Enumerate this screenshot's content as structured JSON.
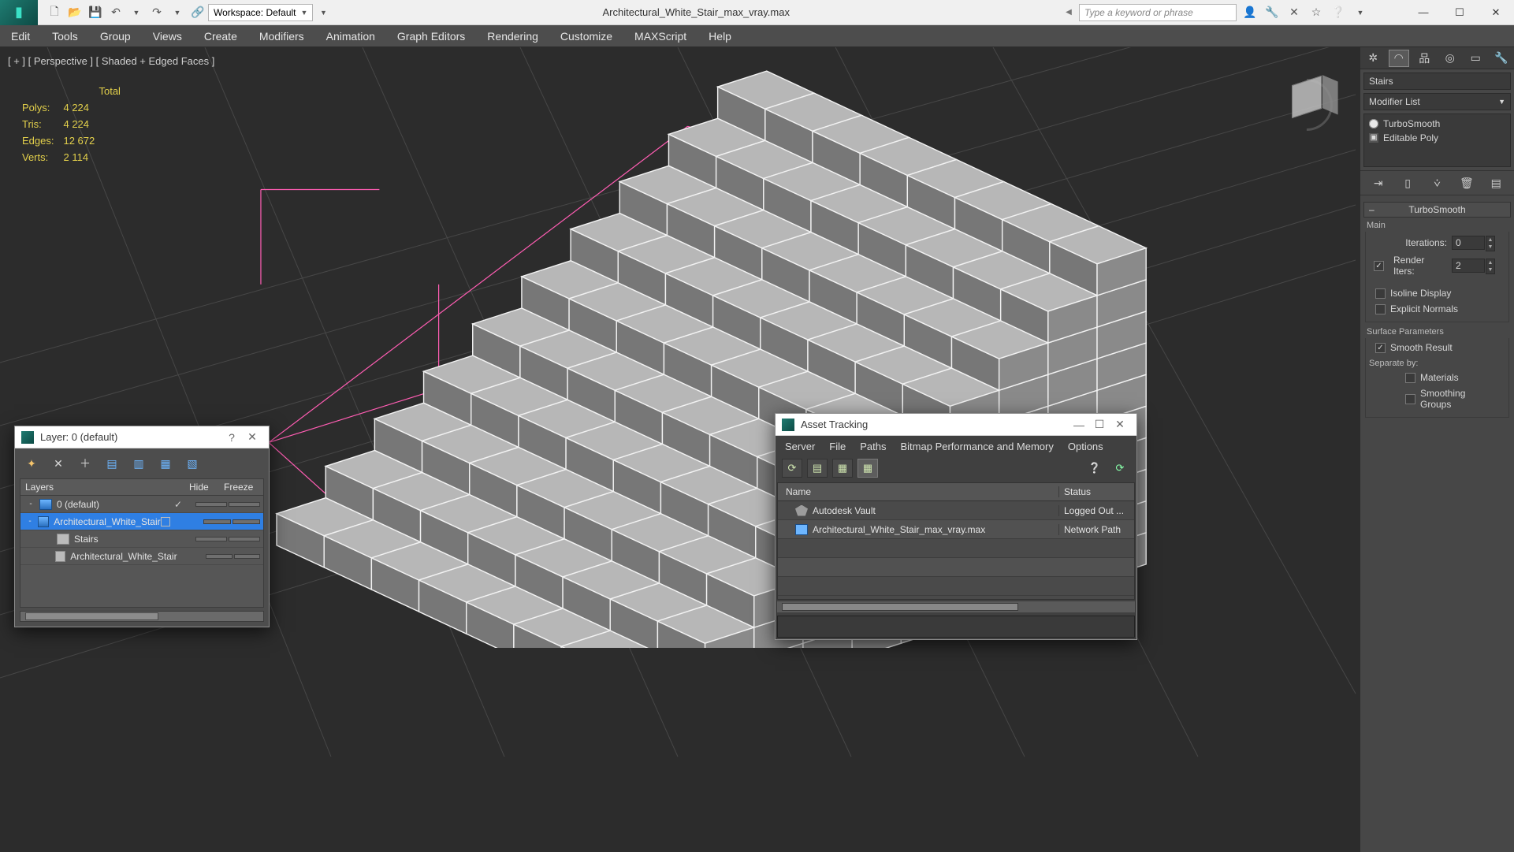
{
  "titlebar": {
    "workspace_label": "Workspace: Default",
    "title": "Architectural_White_Stair_max_vray.max",
    "search_placeholder": "Type a keyword or phrase"
  },
  "mainmenu": [
    "Edit",
    "Tools",
    "Group",
    "Views",
    "Create",
    "Modifiers",
    "Animation",
    "Graph Editors",
    "Rendering",
    "Customize",
    "MAXScript",
    "Help"
  ],
  "viewport": {
    "label": "[ + ] [ Perspective ] [ Shaded + Edged Faces ]",
    "stats_header": "Total",
    "stats": {
      "polys_label": "Polys:",
      "polys": "4 224",
      "tris_label": "Tris:",
      "tris": "4 224",
      "edges_label": "Edges:",
      "edges": "12 672",
      "verts_label": "Verts:",
      "verts": "2 114"
    }
  },
  "cmdpanel": {
    "object_name": "Stairs",
    "modifier_list_label": "Modifier List",
    "stack": [
      {
        "name": "TurboSmooth",
        "icon": "bulb"
      },
      {
        "name": "Editable Poly",
        "icon": "plus"
      }
    ],
    "rollout": {
      "title": "TurboSmooth",
      "group_main": "Main",
      "iterations_label": "Iterations:",
      "iterations_value": "0",
      "render_iters_label": "Render Iters:",
      "render_iters_value": "2",
      "render_iters_checked": true,
      "isoline_label": "Isoline Display",
      "isoline_checked": false,
      "explicit_label": "Explicit Normals",
      "explicit_checked": false,
      "surface_params_label": "Surface Parameters",
      "smooth_result_label": "Smooth Result",
      "smooth_result_checked": true,
      "separate_label": "Separate by:",
      "materials_label": "Materials",
      "smoothing_groups_label": "Smoothing Groups"
    }
  },
  "layer_dialog": {
    "title": "Layer: 0 (default)",
    "columns": {
      "name": "Layers",
      "hide": "Hide",
      "freeze": "Freeze"
    },
    "rows": [
      {
        "indent": 0,
        "type": "layer",
        "name": "0 (default)",
        "hide_checked": true,
        "selected": false,
        "expand": "-"
      },
      {
        "indent": 0,
        "type": "layer",
        "name": "Architectural_White_Stair",
        "hide_checked": false,
        "selected": true,
        "expand": "-",
        "box": true
      },
      {
        "indent": 1,
        "type": "obj",
        "name": "Stairs",
        "selected": false
      },
      {
        "indent": 1,
        "type": "obj",
        "name": "Architectural_White_Stair",
        "selected": false
      }
    ]
  },
  "asset_dialog": {
    "title": "Asset Tracking",
    "menu": [
      "Server",
      "File",
      "Paths",
      "Bitmap Performance and Memory",
      "Options"
    ],
    "columns": {
      "name": "Name",
      "status": "Status"
    },
    "rows": [
      {
        "icon": "vault",
        "name": "Autodesk Vault",
        "status": "Logged Out ..."
      },
      {
        "icon": "file",
        "name": "Architectural_White_Stair_max_vray.max",
        "status": "Network Path"
      }
    ]
  }
}
